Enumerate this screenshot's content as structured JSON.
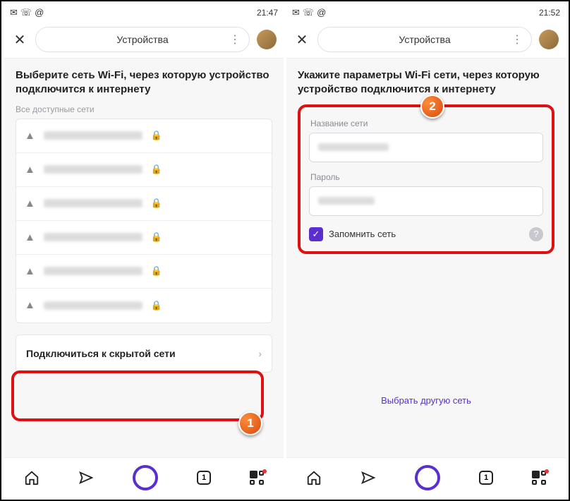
{
  "left": {
    "status": {
      "time": "21:47"
    },
    "header": {
      "title": "Устройства"
    },
    "heading": "Выберите сеть Wi-Fi, через которую устройство подключится к интернету",
    "section_label": "Все доступные сети",
    "hidden_network": "Подключиться к скрытой сети",
    "badge": "1"
  },
  "right": {
    "status": {
      "time": "21:52"
    },
    "header": {
      "title": "Устройства"
    },
    "heading": "Укажите параметры Wi-Fi сети, через которую устройство подключится к интернету",
    "name_label": "Название сети",
    "pass_label": "Пароль",
    "remember_label": "Запомнить сеть",
    "other_link": "Выбрать другую сеть",
    "badge": "2"
  }
}
